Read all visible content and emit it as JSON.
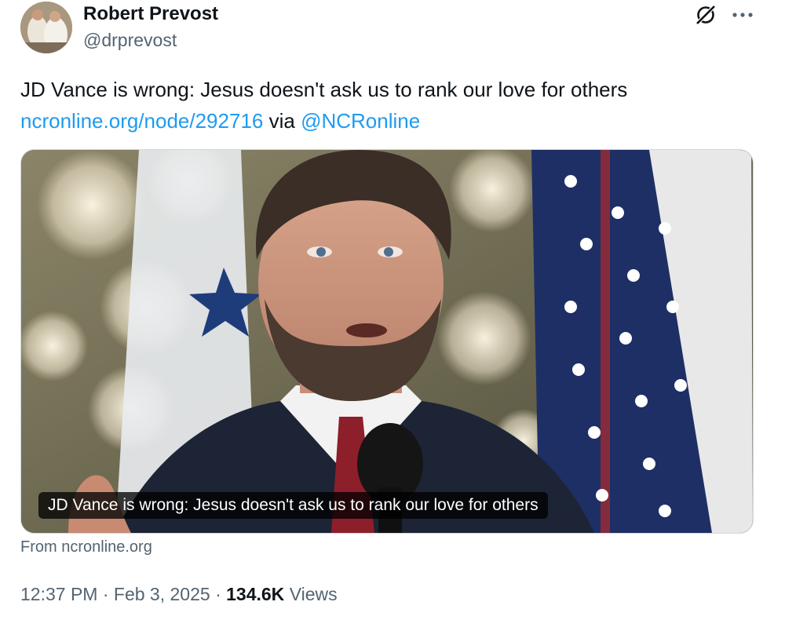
{
  "author": {
    "name": "Robert Prevost",
    "handle": "@drprevost"
  },
  "header_icons": {
    "grok": "grok-icon",
    "more": "more-options-icon"
  },
  "tweet": {
    "text": "JD Vance is wrong: Jesus doesn't ask us to rank our love for others",
    "link": "ncronline.org/node/292716",
    "via_word": "via",
    "mention": "@NCRonline"
  },
  "card": {
    "caption": "JD Vance is wrong: Jesus doesn't ask us to rank our love for others",
    "source": "From ncronline.org"
  },
  "meta": {
    "time": "12:37 PM",
    "separator": "·",
    "date": "Feb 3, 2025",
    "views_count": "134.6K",
    "views_label": "Views"
  },
  "colors": {
    "link": "#1d9bf0",
    "text": "#0f1419",
    "secondary": "#536471",
    "border": "#cfd9de"
  }
}
